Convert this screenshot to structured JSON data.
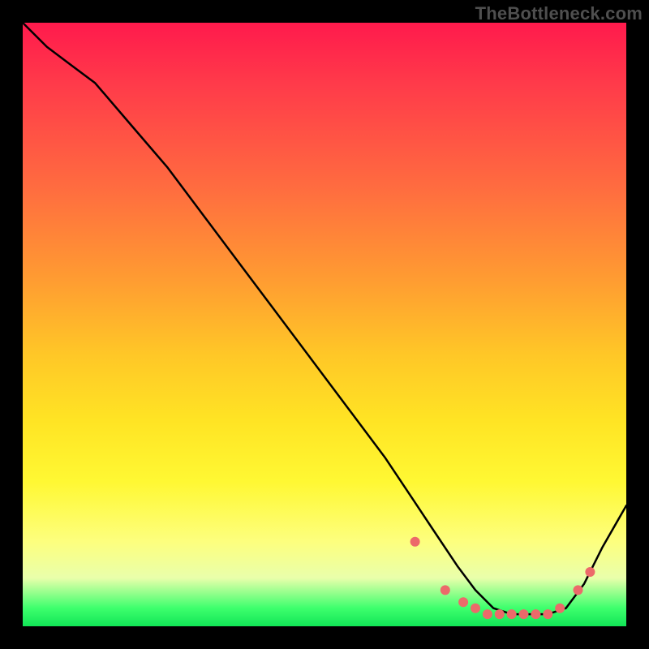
{
  "watermark": "TheBottleneck.com",
  "colors": {
    "background": "#000000",
    "watermark_text": "#4f4f4f",
    "curve": "#000000",
    "dot": "#ec6a6a",
    "gradient_top": "#ff1a4c",
    "gradient_bottom": "#11e556"
  },
  "chart_data": {
    "type": "line",
    "title": "",
    "xlabel": "",
    "ylabel": "",
    "xlim": [
      0,
      100
    ],
    "ylim": [
      0,
      100
    ],
    "grid": false,
    "legend": false,
    "series": [
      {
        "name": "bottleneck-curve",
        "x": [
          0,
          4,
          8,
          12,
          18,
          24,
          30,
          36,
          42,
          48,
          54,
          60,
          64,
          68,
          72,
          75,
          78,
          81,
          84,
          87,
          90,
          93,
          96,
          100
        ],
        "y": [
          100,
          96,
          93,
          90,
          83,
          76,
          68,
          60,
          52,
          44,
          36,
          28,
          22,
          16,
          10,
          6,
          3,
          2,
          2,
          2,
          3,
          7,
          13,
          20
        ]
      }
    ],
    "marked_points": {
      "name": "highlight",
      "x": [
        65,
        70,
        73,
        75,
        77,
        79,
        81,
        83,
        85,
        87,
        89,
        92,
        94
      ],
      "y": [
        14,
        6,
        4,
        3,
        2,
        2,
        2,
        2,
        2,
        2,
        3,
        6,
        9
      ]
    }
  }
}
